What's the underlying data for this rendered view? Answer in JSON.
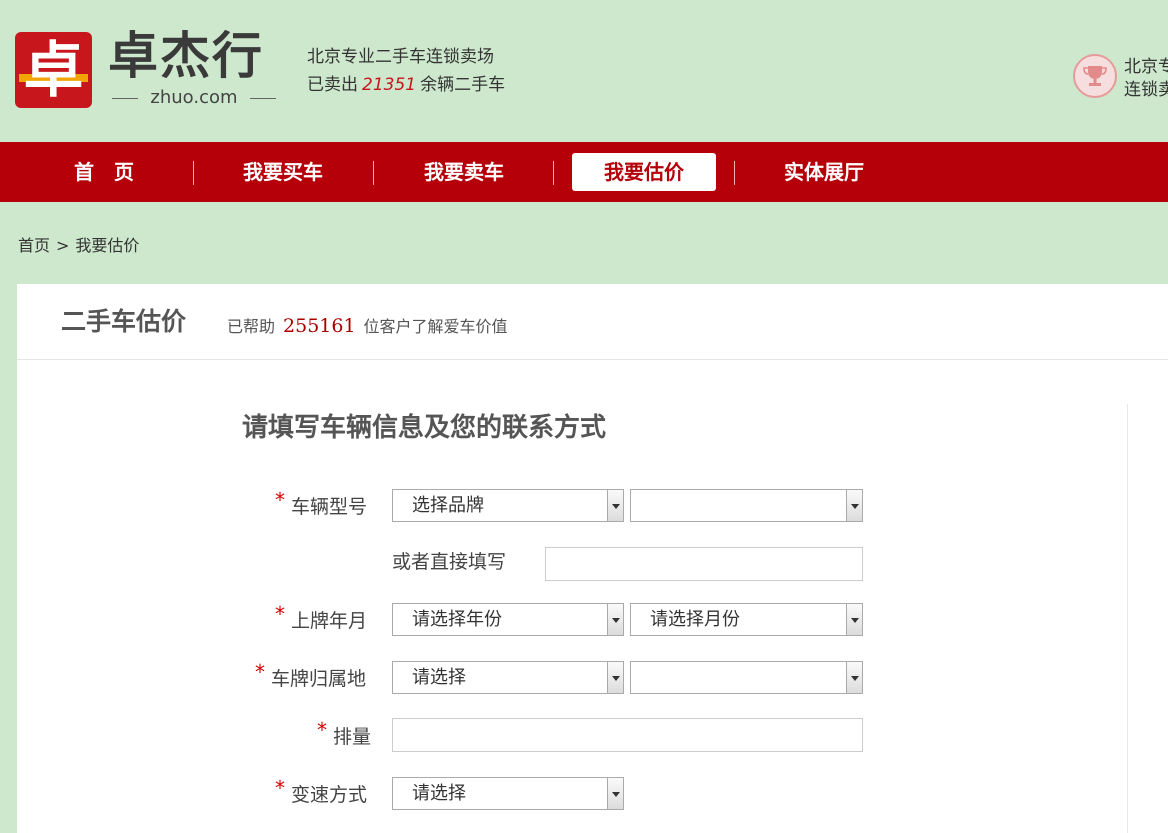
{
  "header": {
    "logo_glyph": "卓",
    "logo_name": "卓杰行",
    "logo_domain": "zhuo.com",
    "tagline": "北京专业二手车连锁卖场",
    "sold_prefix": "已卖出",
    "sold_count": "21351",
    "sold_suffix": "余辆二手车",
    "side_line1": "北京专",
    "side_line2": "连锁卖"
  },
  "nav": {
    "items": [
      {
        "label": "首　页",
        "active": false
      },
      {
        "label": "我要买车",
        "active": false
      },
      {
        "label": "我要卖车",
        "active": false
      },
      {
        "label": "我要估价",
        "active": true
      },
      {
        "label": "实体展厅",
        "active": false
      }
    ]
  },
  "breadcrumb": {
    "home": "首页",
    "separator": ">",
    "current": "我要估价"
  },
  "card": {
    "title": "二手车估价",
    "stat_prefix": "已帮助",
    "stat_count": "255161",
    "stat_suffix": "位客户了解爱车价值"
  },
  "form": {
    "title": "请填写车辆信息及您的联系方式",
    "required_mark": "*",
    "model_label": "车辆型号",
    "brand_select": "选择品牌",
    "series_select": "",
    "direct_label": "或者直接填写",
    "direct_value": "",
    "reg_label": "上牌年月",
    "year_select": "请选择年份",
    "month_select": "请选择月份",
    "plate_label": "车牌归属地",
    "province_select": "请选择",
    "city_select": "",
    "displacement_label": "排量",
    "displacement_value": "",
    "gearbox_label": "变速方式",
    "gearbox_select": "请选择"
  },
  "colors": {
    "background": "#cde8cd",
    "nav_red": "#b5000a",
    "accent_red": "#c8161d"
  }
}
